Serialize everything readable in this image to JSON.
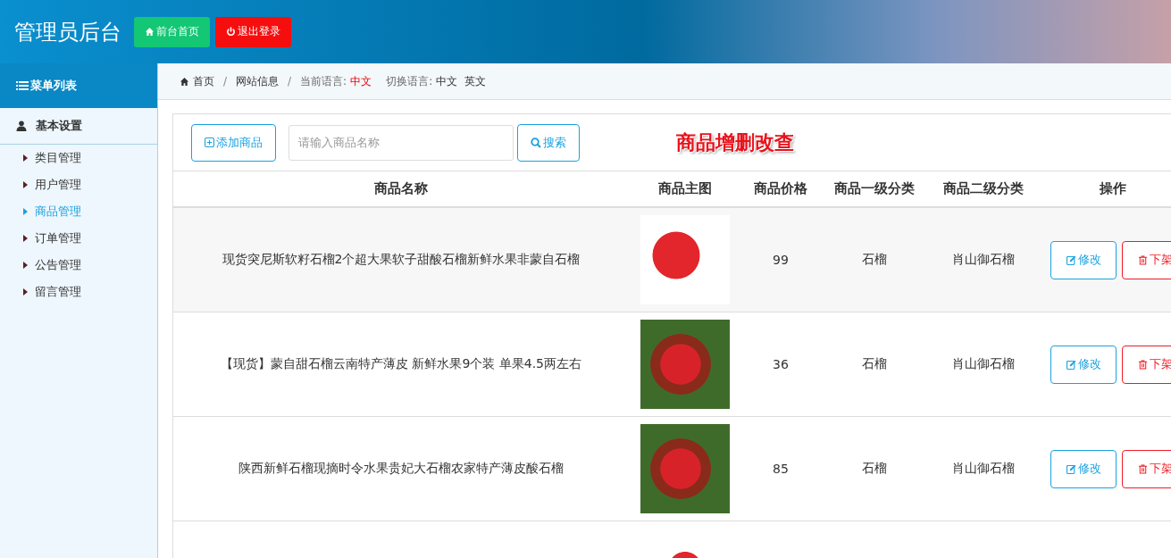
{
  "header": {
    "title": "管理员后台",
    "buttons": [
      {
        "kind": "home",
        "label": "前台首页"
      },
      {
        "kind": "logout",
        "label": "退出登录"
      }
    ]
  },
  "sidebar": {
    "title": "菜单列表",
    "group": "基本设置",
    "items": [
      {
        "label": "类目管理",
        "selected": false
      },
      {
        "label": "用户管理",
        "selected": false
      },
      {
        "label": "商品管理",
        "selected": true
      },
      {
        "label": "订单管理",
        "selected": false
      },
      {
        "label": "公告管理",
        "selected": false
      },
      {
        "label": "留言管理",
        "selected": false
      }
    ]
  },
  "breadcrumb": {
    "items": [
      "首页",
      "网站信息"
    ],
    "separator": "/",
    "current_language_label": "当前语言:",
    "current_language": "中文",
    "switch_label": "切换语言:",
    "languages": [
      "中文",
      "英文"
    ]
  },
  "toolbar": {
    "add_button": "添加商品",
    "search": {
      "placeholder": "请输入商品名称"
    },
    "search_button": "搜索",
    "heading": "商品增删改查"
  },
  "table": {
    "columns": [
      "商品名称",
      "商品主图",
      "商品价格",
      "商品一级分类",
      "商品二级分类",
      "操作"
    ],
    "rows": [
      {
        "name": "现货突尼斯软籽石榴2个超大果软子甜酸石榴新鲜水果非蒙自石榴",
        "price": "99",
        "category_1": "石榴",
        "category_2": "肖山御石榴",
        "edit": "修改",
        "remove": "下架",
        "selected": true
      },
      {
        "name": "【现货】蒙自甜石榴云南特产薄皮 新鲜水果9个装 单果4.5两左右",
        "price": "36",
        "category_1": "石榴",
        "category_2": "肖山御石榴",
        "edit": "修改",
        "remove": "下架",
        "selected": false
      },
      {
        "name": "陕西新鲜石榴现摘时令水果贵妃大石榴农家特产薄皮酸石榴",
        "price": "85",
        "category_1": "石榴",
        "category_2": "肖山御石榴",
        "edit": "修改",
        "remove": "下架",
        "selected": false
      }
    ],
    "partial_row": {
      "image": true
    }
  }
}
